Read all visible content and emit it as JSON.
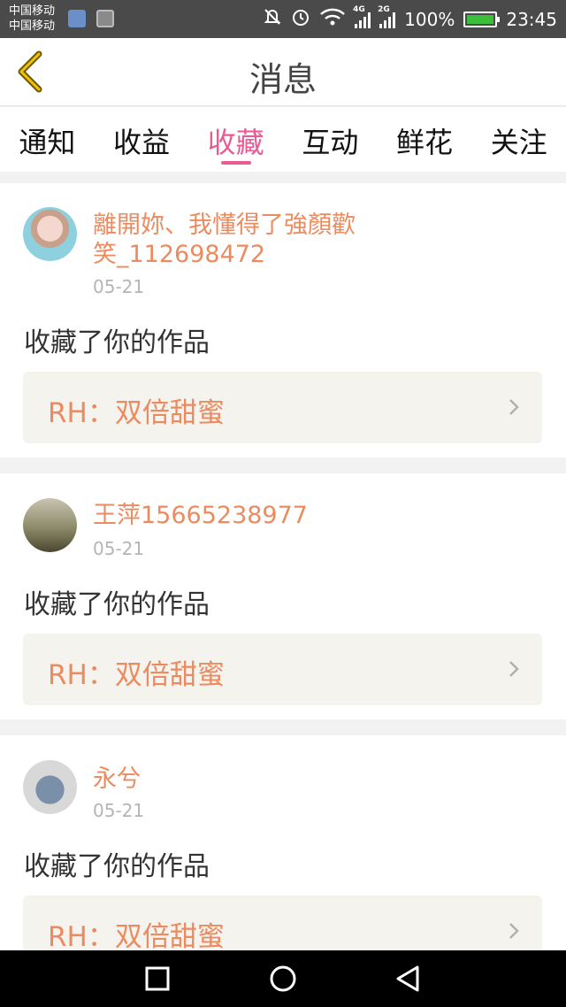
{
  "status_bar": {
    "carrier_1": "中国移动",
    "carrier_2": "中国移动",
    "network_1": "4G",
    "network_2": "2G",
    "battery": "100%",
    "time": "23:45"
  },
  "header": {
    "title": "消息",
    "back_icon": "chevron-left-icon"
  },
  "tabs": [
    {
      "label": "通知",
      "active": false
    },
    {
      "label": "收益",
      "active": false
    },
    {
      "label": "收藏",
      "active": true
    },
    {
      "label": "互动",
      "active": false
    },
    {
      "label": "鲜花",
      "active": false
    },
    {
      "label": "关注",
      "active": false
    }
  ],
  "messages": [
    {
      "username": "離開妳、我懂得了強顏歡笑_112698472",
      "date": "05-21",
      "action": "收藏了你的作品",
      "work_title": "RH：双倍甜蜜"
    },
    {
      "username": "王萍15665238977",
      "date": "05-21",
      "action": "收藏了你的作品",
      "work_title": "RH：双倍甜蜜"
    },
    {
      "username": "永兮",
      "date": "05-21",
      "action": "收藏了你的作品",
      "work_title": "RH：双倍甜蜜"
    }
  ],
  "colors": {
    "accent": "#ea5b93",
    "username": "#eb8b5f",
    "back_arrow": "#d6b000"
  }
}
